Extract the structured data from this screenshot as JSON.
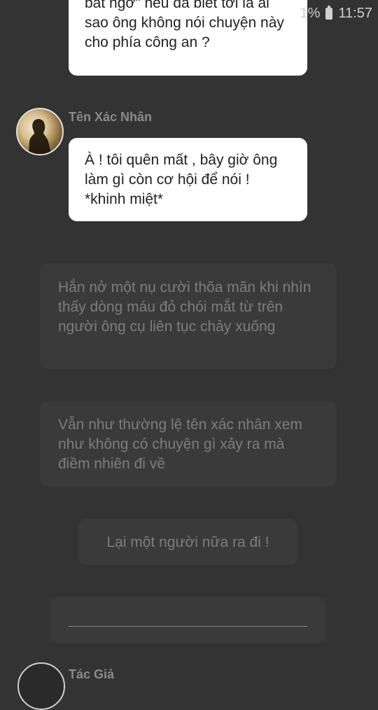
{
  "status_bar": {
    "battery_text": "1%",
    "time": "11:57"
  },
  "messages": [
    {
      "text": "bất ngờ\" nếu đã biết tới là ai sao ông không nói chuyện này cho phía công an ?"
    },
    {
      "sender": "Tên Xác Nhân",
      "text": "À ! tôi quên mất , bây giờ ông làm gì còn cơ hội để nói ! *khinh miệt*"
    }
  ],
  "narrations": [
    "Hắn nở một nụ cười thõa mãn khi nhìn thấy dòng máu đỏ chói mắt từ trên người ông cụ liên tục chảy xuống",
    "Vẫn như thường lệ tên xác nhân xem như không có chuyện gì xảy ra mà điềm nhiên đi về",
    "Lại một người nữa ra đi !"
  ],
  "bottom_sender": "Tác Giả",
  "colors": {
    "background": "#333333",
    "bubble": "#ffffff",
    "narration_bg": "#3a3a3a",
    "narration_text": "#7d7d7d"
  }
}
